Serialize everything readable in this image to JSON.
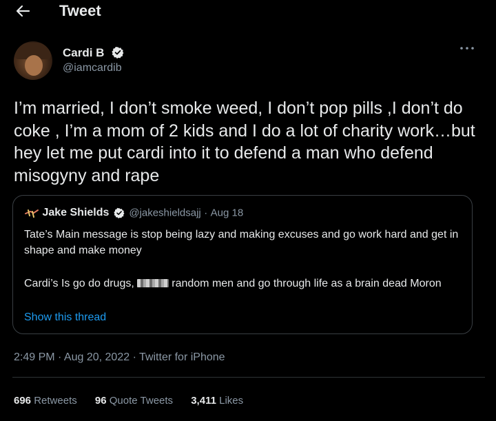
{
  "header": {
    "back_icon": "arrow-left-icon",
    "title": "Tweet"
  },
  "author": {
    "name": "Cardi B",
    "handle": "@iamcardib",
    "verified": true,
    "verified_color": "#e7e9ea"
  },
  "tweet": {
    "text": "I’m married, I don’t smoke weed, I don’t pop pills ,I don’t do coke , I’m a mom of 2 kids and I do a lot of charity work…but hey let me put cardi into it to defend a man who defend misogyny and rape"
  },
  "quoted": {
    "name": "Jake Shields",
    "handle": "@jakeshieldsajj",
    "separator": "·",
    "date": "Aug 18",
    "paragraph1": "Tate’s Main message is stop being lazy and making excuses and go work hard and get in shape and make money",
    "paragraph2_before": "Cardi’s Is go do drugs,",
    "paragraph2_after": "random men and go through life as a brain dead Moron",
    "show_thread": "Show this thread"
  },
  "meta": {
    "text": "2:49 PM · Aug 20, 2022 · Twitter for iPhone"
  },
  "stats": [
    {
      "count": "696",
      "label": "Retweets"
    },
    {
      "count": "96",
      "label": "Quote Tweets"
    },
    {
      "count": "3,411",
      "label": "Likes"
    }
  ],
  "colors": {
    "background": "#000000",
    "text": "#e7e9ea",
    "muted": "#8b98a5",
    "link": "#1d9bf0",
    "border": "#3a3f44"
  }
}
